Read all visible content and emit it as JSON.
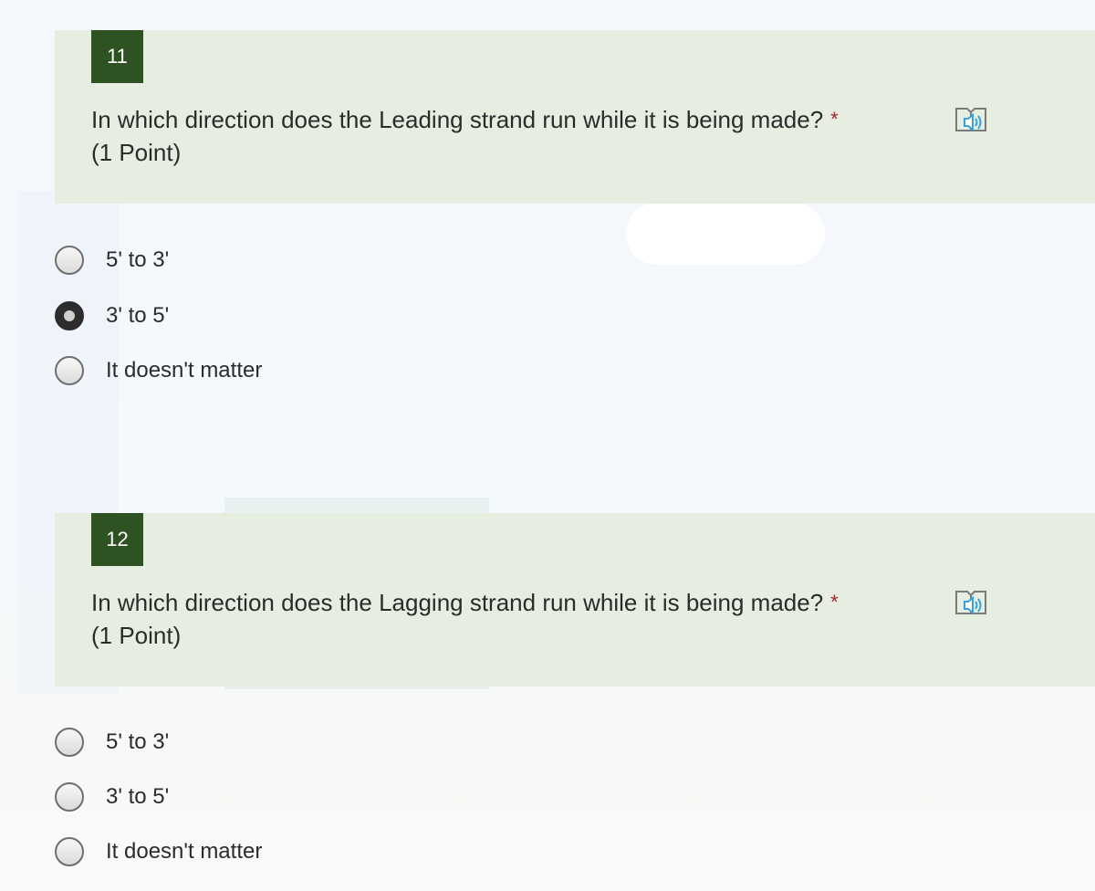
{
  "questions": [
    {
      "number": "11",
      "title": "In which direction does the Leading strand run while it is being made?",
      "required_mark": "*",
      "points": "(1 Point)",
      "reader_icon": "immersive-reader-icon",
      "options": [
        {
          "label": "5' to 3'",
          "selected": false
        },
        {
          "label": "3' to 5'",
          "selected": true
        },
        {
          "label": "It doesn't matter",
          "selected": false
        }
      ]
    },
    {
      "number": "12",
      "title": "In which direction does the Lagging strand run while it is being made?",
      "required_mark": "*",
      "points": "(1 Point)",
      "reader_icon": "immersive-reader-icon",
      "options": [
        {
          "label": "5' to 3'",
          "selected": false
        },
        {
          "label": "3' to 5'",
          "selected": false
        },
        {
          "label": "It doesn't matter",
          "selected": false
        }
      ]
    }
  ],
  "colors": {
    "header_bg": "#e6eee2",
    "number_badge_bg": "#2f5223",
    "required_mark": "#a4262c",
    "reader_icon_blue": "#3aa0da"
  }
}
